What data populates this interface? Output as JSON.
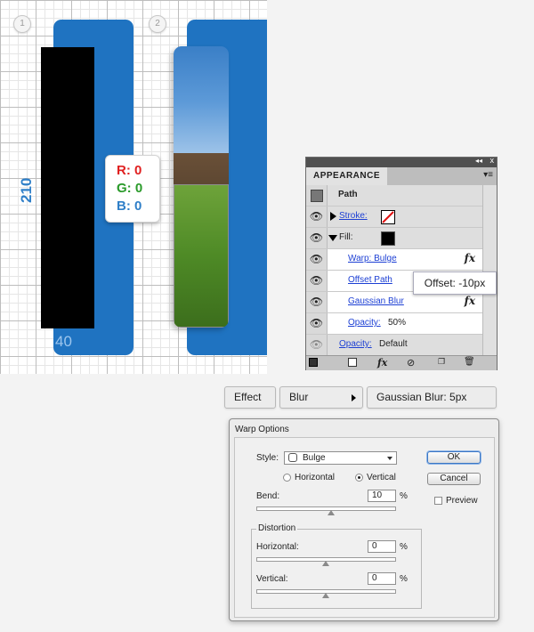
{
  "artboard": {
    "step1": "1",
    "step2": "2",
    "height_label": "210",
    "width_label": "40",
    "rgb": {
      "r": "R: 0",
      "g": "G: 0",
      "b": "B: 0"
    }
  },
  "colors": {
    "accent_blue": "#1f73c1",
    "r_red": "#e02020",
    "g_green": "#2a9a2a",
    "b_blue": "#2f7fc8"
  },
  "appearance": {
    "tab": "APPEARANCE",
    "path_label": "Path",
    "stroke_label": "Stroke:",
    "fill_label": "Fill:",
    "effects": [
      {
        "label": "Warp: Bulge",
        "fx": "fx"
      },
      {
        "label": "Offset Path",
        "fx": ""
      },
      {
        "label": "Gaussian Blur",
        "fx": "fx"
      }
    ],
    "inner_opacity_label": "Opacity:",
    "inner_opacity_value": "50%",
    "opacity_label": "Opacity:",
    "opacity_value": "Default",
    "collapse": "◂◂",
    "close": "x",
    "menu": "▾≡"
  },
  "offset_tip": "Offset: -10px",
  "effect_path": {
    "effect": "Effect",
    "blur": "Blur",
    "gaussian": "Gaussian Blur: 5px"
  },
  "warp": {
    "title": "Warp Options",
    "style_label": "Style:",
    "style_value": "Bulge",
    "horizontal_radio": "Horizontal",
    "vertical_radio": "Vertical",
    "bend_label": "Bend:",
    "bend_value": "10",
    "percent": "%",
    "distortion_label": "Distortion",
    "dist_horizontal_label": "Horizontal:",
    "dist_horizontal_value": "0",
    "dist_vertical_label": "Vertical:",
    "dist_vertical_value": "0",
    "ok": "OK",
    "cancel": "Cancel",
    "preview": "Preview"
  }
}
